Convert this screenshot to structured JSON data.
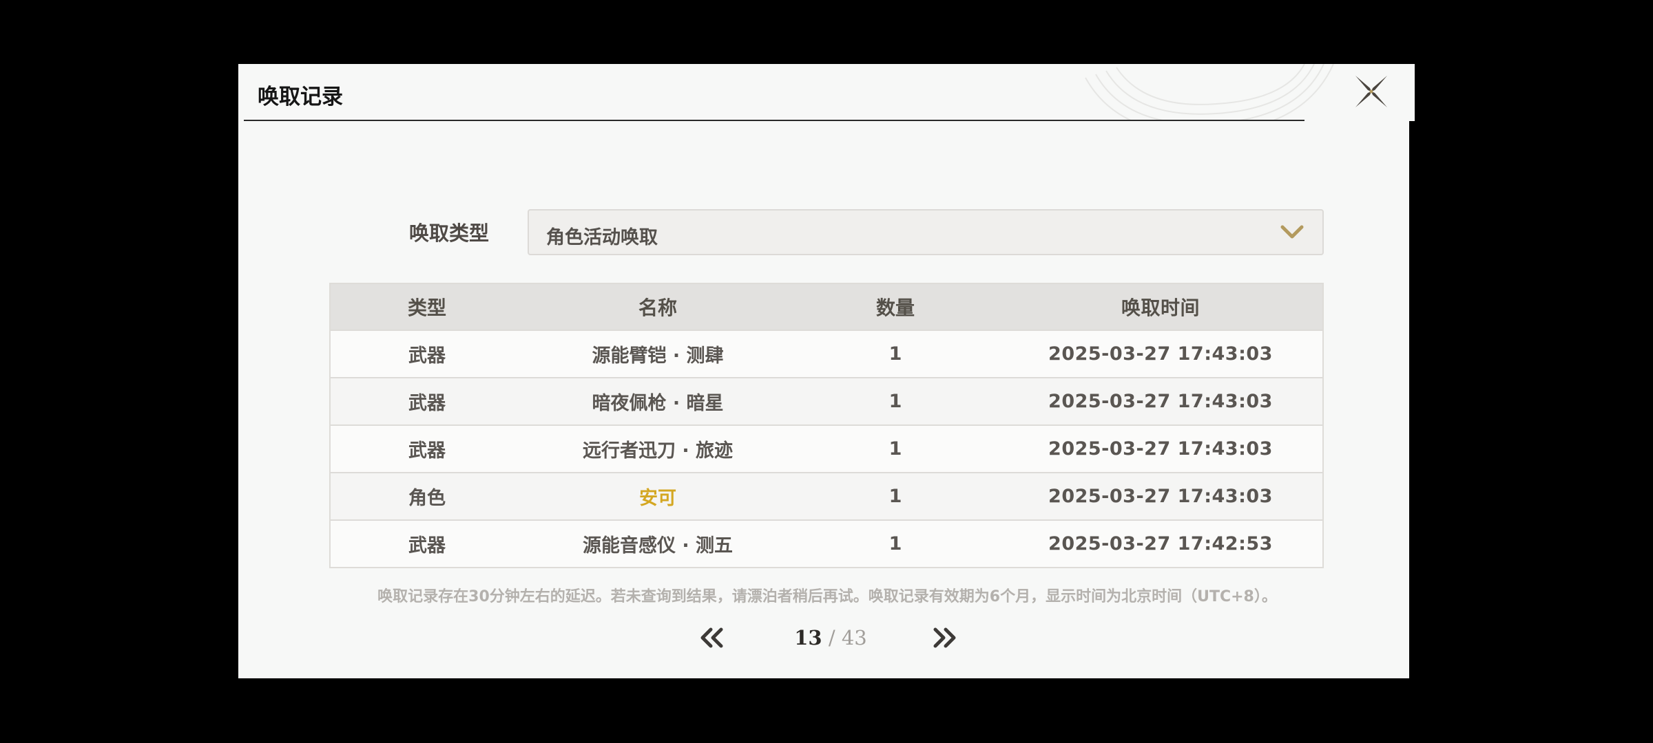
{
  "dialog": {
    "title": "唤取记录"
  },
  "filter": {
    "label": "唤取类型",
    "selected": "角色活动唤取"
  },
  "table": {
    "headers": [
      "类型",
      "名称",
      "数量",
      "唤取时间"
    ],
    "rows": [
      {
        "type": "武器",
        "name": "源能臂铠 · 测肆",
        "count": "1",
        "time": "2025-03-27 17:43:03",
        "highlight": false
      },
      {
        "type": "武器",
        "name": "暗夜佩枪 · 暗星",
        "count": "1",
        "time": "2025-03-27 17:43:03",
        "highlight": false
      },
      {
        "type": "武器",
        "name": "远行者迅刀 · 旅迹",
        "count": "1",
        "time": "2025-03-27 17:43:03",
        "highlight": false
      },
      {
        "type": "角色",
        "name": "安可",
        "count": "1",
        "time": "2025-03-27 17:43:03",
        "highlight": true
      },
      {
        "type": "武器",
        "name": "源能音感仪 · 测五",
        "count": "1",
        "time": "2025-03-27 17:42:53",
        "highlight": false
      }
    ]
  },
  "notice": "唤取记录存在30分钟左右的延迟。若未查询到结果，请漂泊者稍后再试。唤取记录有效期为6个月，显示时间为北京时间（UTC+8）。",
  "pagination": {
    "current": "13",
    "separator": " / ",
    "total": "43"
  },
  "colors": {
    "highlight": "#d4a722",
    "accent": "#b39a5e",
    "text": "#5a5652"
  },
  "icons": {
    "close": "close-x-icon",
    "dropdown": "chevron-down-icon",
    "prev": "double-chevron-left-icon",
    "next": "double-chevron-right-icon"
  }
}
